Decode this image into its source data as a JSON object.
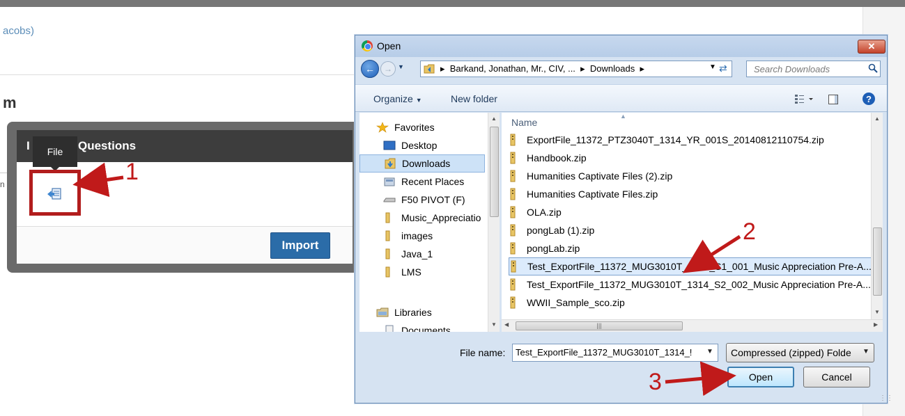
{
  "background": {
    "link_fragment": "acobs)",
    "heading_fragment": "m",
    "side_fragment": "n",
    "modal": {
      "title_left": "I",
      "title_right": "Questions",
      "import_label": "Import"
    },
    "tooltip": "File"
  },
  "annotations": {
    "one": "1",
    "two": "2",
    "three": "3",
    "color": "#c01a1a"
  },
  "dialog": {
    "title": "Open",
    "close_label": "✕",
    "address": {
      "segments": [
        "Barkand, Jonathan, Mr., CIV, ...",
        "Downloads"
      ]
    },
    "search_placeholder": "Search Downloads",
    "toolbar": {
      "organize": "Organize",
      "new_folder": "New folder",
      "help": "?"
    },
    "nav": {
      "favorites": "Favorites",
      "items": [
        "Desktop",
        "Downloads",
        "Recent Places",
        "F50 PIVOT (F)",
        "Music_Appreciatio",
        "images",
        "Java_1",
        "LMS"
      ],
      "libraries": "Libraries",
      "documents": "Documents"
    },
    "files": {
      "column_name": "Name",
      "rows": [
        "ExportFile_11372_PTZ3040T_1314_YR_001S_20140812110754.zip",
        "Handbook.zip",
        "Humanities Captivate Files (2).zip",
        "Humanities Captivate Files.zip",
        "OLA.zip",
        "pongLab (1).zip",
        "pongLab.zip",
        "Test_ExportFile_11372_MUG3010T_1314_S1_001_Music Appreciation Pre-A...",
        "Test_ExportFile_11372_MUG3010T_1314_S2_002_Music Appreciation Pre-A...",
        "WWII_Sample_sco.zip"
      ],
      "selected_index": 7
    },
    "bottom": {
      "file_name_label": "File name:",
      "file_name_value": "Test_ExportFile_11372_MUG3010T_1314_!",
      "filter": "Compressed (zipped) Folde",
      "open": "Open",
      "cancel": "Cancel"
    }
  }
}
